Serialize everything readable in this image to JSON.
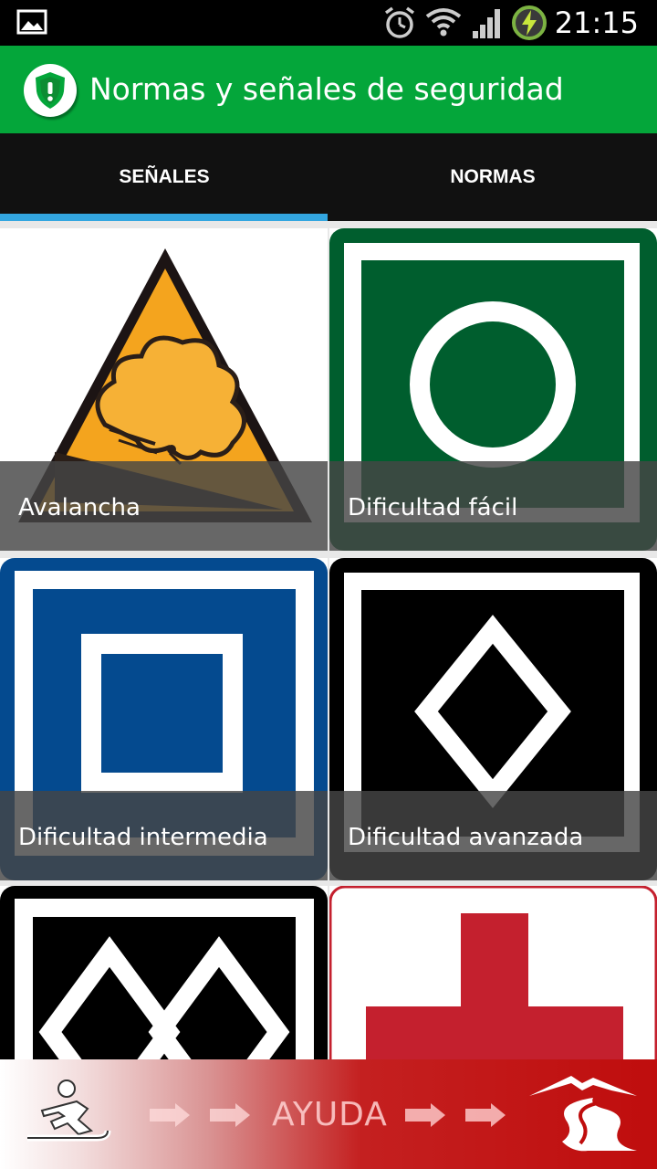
{
  "status_bar": {
    "time": "21:15",
    "icons": [
      "gallery-icon",
      "alarm-icon",
      "wifi-icon",
      "signal-icon",
      "battery-charging-icon"
    ]
  },
  "app_bar": {
    "title": "Normas y señales de seguridad",
    "logo_icon": "shield-alert-icon",
    "color": "#04a63a"
  },
  "tabs": [
    {
      "label": "SEÑALES",
      "selected": true
    },
    {
      "label": "NORMAS",
      "selected": false
    }
  ],
  "tab_indicator_color": "#33a6e0",
  "signs": [
    {
      "label": "Avalancha",
      "icon": "avalanche-warning-icon"
    },
    {
      "label": "Dificultad fácil",
      "icon": "green-circle-icon"
    },
    {
      "label": "Dificultad intermedia",
      "icon": "blue-square-icon"
    },
    {
      "label": "Dificultad avanzada",
      "icon": "black-diamond-icon"
    },
    {
      "label": "",
      "icon": "double-black-diamond-icon"
    },
    {
      "label": "",
      "icon": "red-cross-icon"
    }
  ],
  "footer": {
    "label": "AYUDA",
    "left_icon": "skier-icon",
    "arrow_icon": "arrow-right-icon",
    "right_icon": "mountain-road-icon"
  }
}
